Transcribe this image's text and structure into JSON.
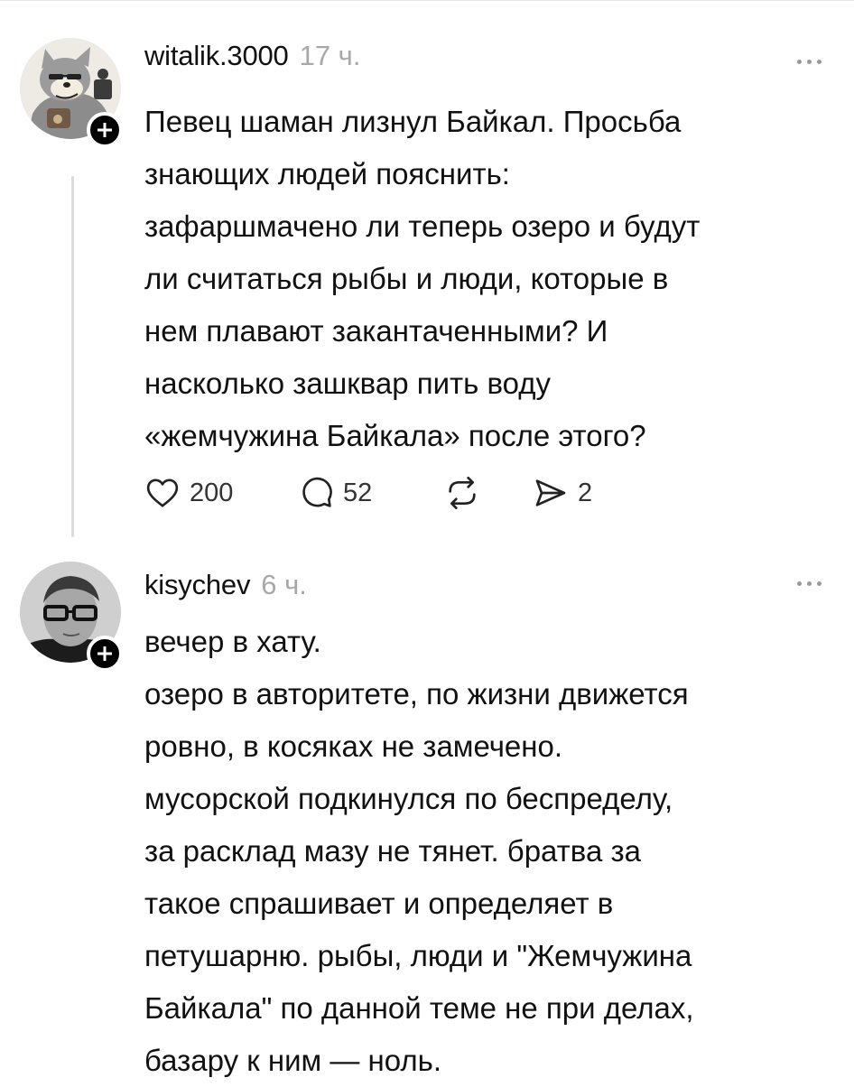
{
  "posts": [
    {
      "username": "witalik.3000",
      "time": "17 ч.",
      "lines": [
        "Певец шаман лизнул Байкал. Просьба",
        "знающих людей пояснить:",
        "зафаршмачено ли теперь озеро и будут",
        "ли считаться рыбы и люди, которые в",
        "нем плавают закантаченными? И",
        "насколько зашквар пить воду",
        "«жемчужина Байкала» после этого?"
      ],
      "likes": "200",
      "comments": "52",
      "shares": "2"
    },
    {
      "username": "kisychev",
      "time": "6 ч.",
      "lines": [
        "вечер в хату.",
        "озеро в авторитете, по жизни движется",
        "ровно, в косяках не замечено.",
        "мусорской подкинулся по беспределу,",
        "за расклад мазу не тянет. братва за",
        "такое спрашивает и определяет в",
        "петушарню. рыбы, люди и \"Жемчужина",
        "Байкала\" по данной теме не при делах,",
        "базару к ним — ноль."
      ]
    }
  ]
}
